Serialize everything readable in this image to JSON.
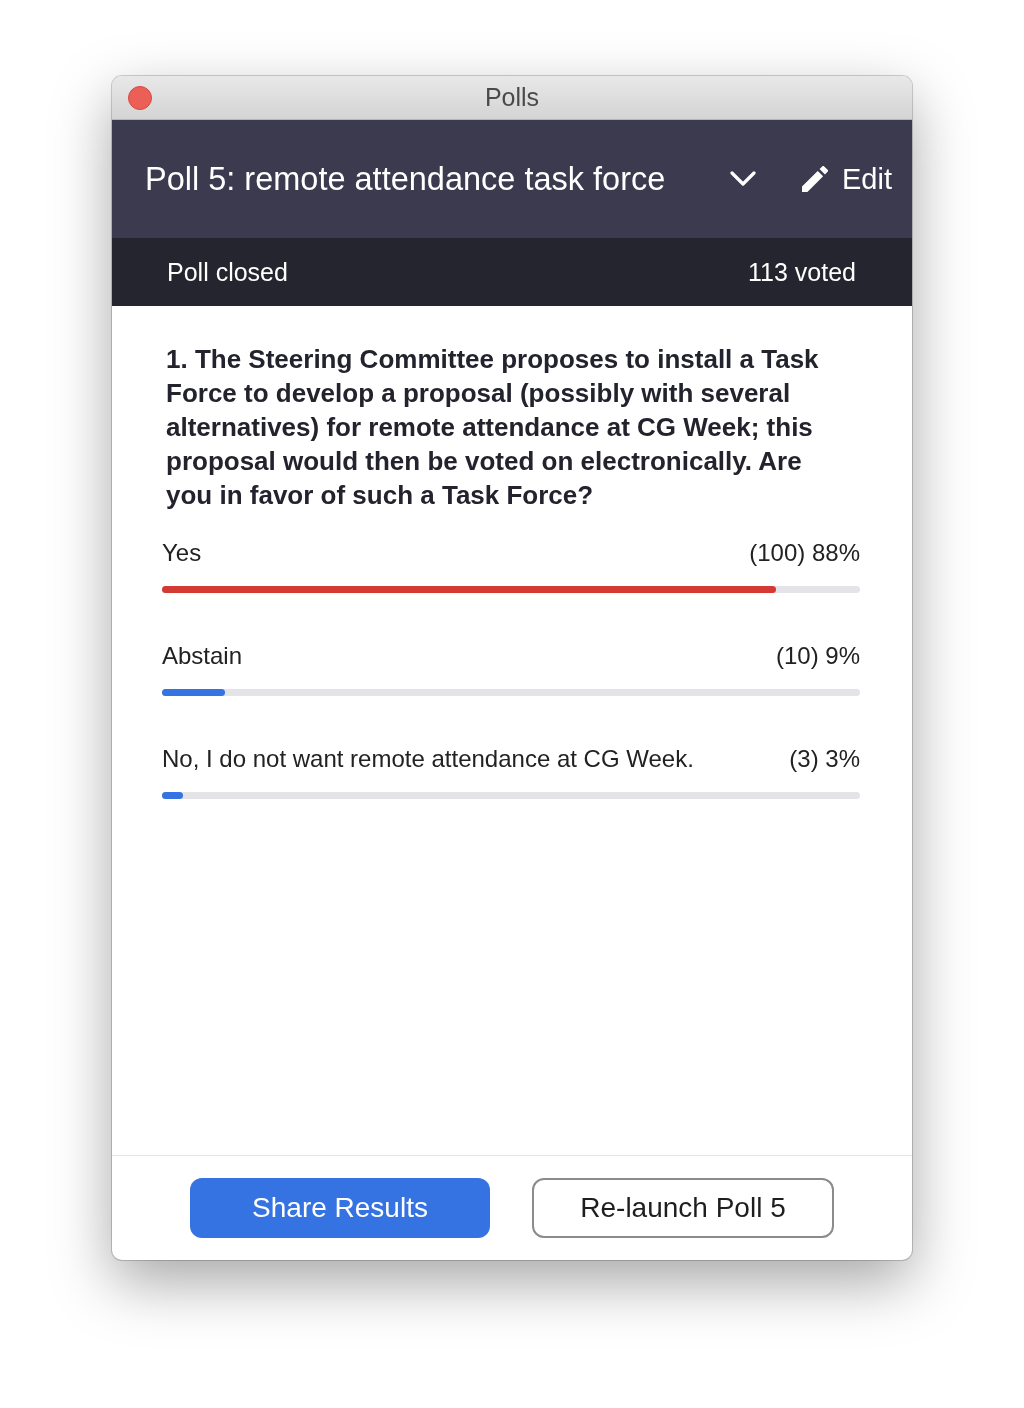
{
  "window": {
    "title": "Polls"
  },
  "header": {
    "poll_title": "Poll 5: remote attendance task force",
    "edit_label": "Edit"
  },
  "status_bar": {
    "state": "Poll closed",
    "votes": "113 voted"
  },
  "question": "1. The Steering Committee proposes to install a Task Force to develop a proposal (possibly with several alternatives) for remote attendance at CG Week; this proposal would then be voted on electronically. Are you in favor of such a Task Force?",
  "answers": [
    {
      "label": "Yes",
      "result": "(100) 88%",
      "level": 0.88,
      "color": "#d43a34"
    },
    {
      "label": "Abstain",
      "result": "(10) 9%",
      "level": 0.09,
      "color": "#3572e2"
    },
    {
      "label": "No, I do not want remote attendance at CG Week.",
      "result": "(3) 3%",
      "level": 0.03,
      "color": "#3572e2"
    }
  ],
  "buttons": [
    {
      "label": "Share Results",
      "kind": "primary"
    },
    {
      "label": "Re-launch Poll 5",
      "kind": "secondary"
    }
  ]
}
